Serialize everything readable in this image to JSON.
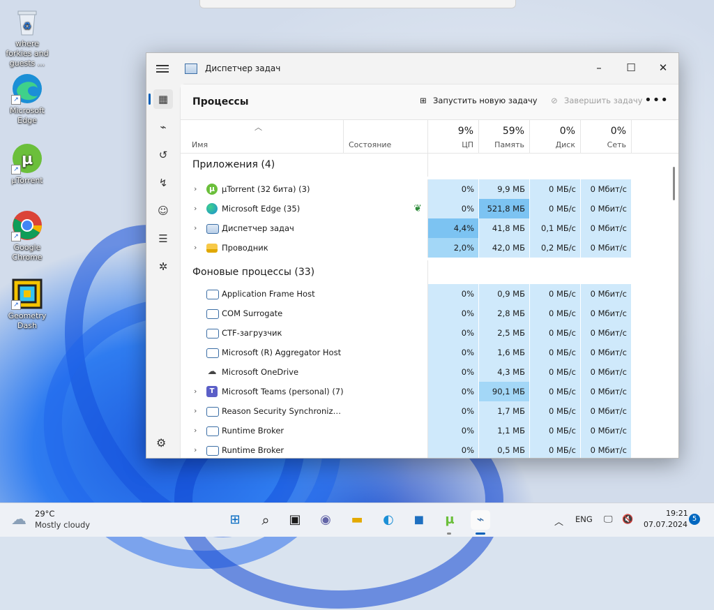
{
  "desktop": {
    "icons": [
      {
        "label": "where forkies and guests ..."
      },
      {
        "label": "Microsoft Edge"
      },
      {
        "label": "µTorrent"
      },
      {
        "label": "Google Chrome"
      },
      {
        "label": "Geometry Dash"
      }
    ]
  },
  "window": {
    "title": "Диспетчер задач",
    "minimize": "–",
    "maximize": "☐",
    "close": "✕"
  },
  "toolbar": {
    "page_title": "Процессы",
    "new_task": "Запустить новую задачу",
    "end_task": "Завершить задачу",
    "more": "•••"
  },
  "columns": {
    "name": "Имя",
    "status": "Состояние",
    "cpu": {
      "pct": "9%",
      "label": "ЦП"
    },
    "memory": {
      "pct": "59%",
      "label": "Память"
    },
    "disk": {
      "pct": "0%",
      "label": "Диск"
    },
    "network": {
      "pct": "0%",
      "label": "Сеть"
    }
  },
  "groups": {
    "apps": "Приложения (4)",
    "background": "Фоновые процессы (33)"
  },
  "apps": [
    {
      "name": "µTorrent (32 бита) (3)",
      "cpu": "0%",
      "mem": "9,9 МБ",
      "disk": "0 МБ/с",
      "net": "0 Мбит/с"
    },
    {
      "name": "Microsoft Edge (35)",
      "cpu": "0%",
      "mem": "521,8 МБ",
      "disk": "0 МБ/с",
      "net": "0 Мбит/с"
    },
    {
      "name": "Диспетчер задач",
      "cpu": "4,4%",
      "mem": "41,8 МБ",
      "disk": "0,1 МБ/с",
      "net": "0 Мбит/с"
    },
    {
      "name": "Проводник",
      "cpu": "2,0%",
      "mem": "42,0 МБ",
      "disk": "0,2 МБ/с",
      "net": "0 Мбит/с"
    }
  ],
  "background": [
    {
      "name": "Application Frame Host",
      "cpu": "0%",
      "mem": "0,9 МБ",
      "disk": "0 МБ/с",
      "net": "0 Мбит/с"
    },
    {
      "name": "COM Surrogate",
      "cpu": "0%",
      "mem": "2,8 МБ",
      "disk": "0 МБ/с",
      "net": "0 Мбит/с"
    },
    {
      "name": "CTF-загрузчик",
      "cpu": "0%",
      "mem": "2,5 МБ",
      "disk": "0 МБ/с",
      "net": "0 Мбит/с"
    },
    {
      "name": "Microsoft (R) Aggregator Host",
      "cpu": "0%",
      "mem": "1,6 МБ",
      "disk": "0 МБ/с",
      "net": "0 Мбит/с"
    },
    {
      "name": "Microsoft OneDrive",
      "cpu": "0%",
      "mem": "4,3 МБ",
      "disk": "0 МБ/с",
      "net": "0 Мбит/с"
    },
    {
      "name": "Microsoft Teams (personal) (7)",
      "cpu": "0%",
      "mem": "90,1 МБ",
      "disk": "0 МБ/с",
      "net": "0 Мбит/с"
    },
    {
      "name": "Reason Security Synchronize S...",
      "cpu": "0%",
      "mem": "1,7 МБ",
      "disk": "0 МБ/с",
      "net": "0 Мбит/с"
    },
    {
      "name": "Runtime Broker",
      "cpu": "0%",
      "mem": "1,1 МБ",
      "disk": "0 МБ/с",
      "net": "0 Мбит/с"
    },
    {
      "name": "Runtime Broker",
      "cpu": "0%",
      "mem": "0,5 МБ",
      "disk": "0 МБ/с",
      "net": "0 Мбит/с"
    }
  ],
  "taskbar": {
    "weather_temp": "29°C",
    "weather_desc": "Mostly cloudy",
    "lang": "ENG",
    "time": "19:21",
    "date": "07.07.2024",
    "notifications": "5"
  },
  "colors": {
    "light_heat": "#cfe9fb",
    "mid_heat": "#a3d7f7",
    "strong_heat": "#7cc3f2",
    "accent": "#005fb8"
  }
}
